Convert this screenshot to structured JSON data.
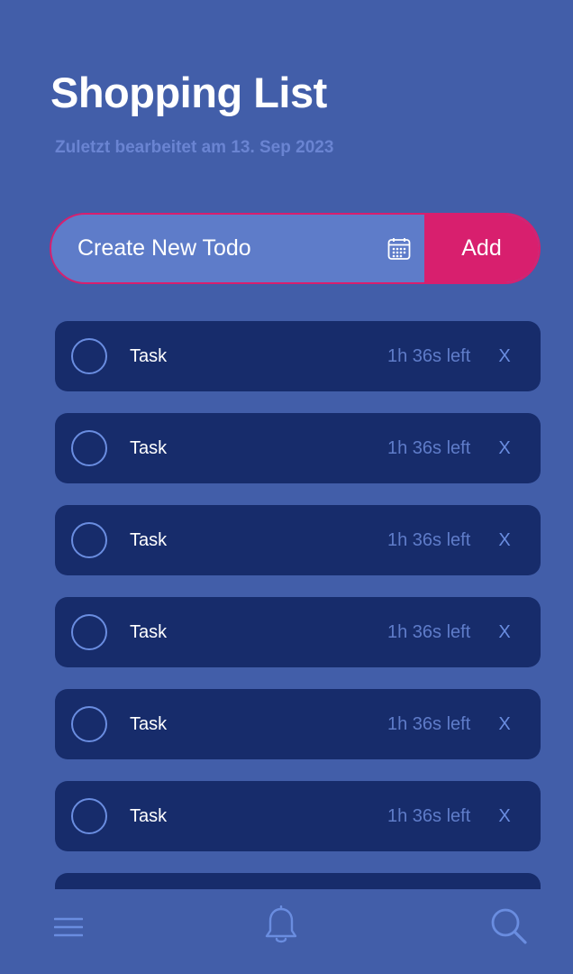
{
  "header": {
    "title": "Shopping List",
    "subtitle": "Zuletzt bearbeitet am 13. Sep 2023"
  },
  "create_bar": {
    "placeholder": "Create New Todo",
    "calendar_icon": "calendar-icon",
    "add_label": "Add"
  },
  "todos": [
    {
      "label": "Task",
      "time_left": "1h 36s left",
      "delete_label": "X",
      "done": false
    },
    {
      "label": "Task",
      "time_left": "1h 36s left",
      "delete_label": "X",
      "done": false
    },
    {
      "label": "Task",
      "time_left": "1h 36s left",
      "delete_label": "X",
      "done": false
    },
    {
      "label": "Task",
      "time_left": "1h 36s left",
      "delete_label": "X",
      "done": false
    },
    {
      "label": "Task",
      "time_left": "1h 36s left",
      "delete_label": "X",
      "done": false
    },
    {
      "label": "Task",
      "time_left": "1h 36s left",
      "delete_label": "X",
      "done": false
    },
    {
      "label": "",
      "time_left": "",
      "delete_label": "",
      "done": false
    }
  ],
  "bottom_nav": {
    "items": [
      "menu-icon",
      "bell-icon",
      "search-icon"
    ]
  },
  "colors": {
    "background": "#425ea9",
    "card": "#172c6b",
    "accent": "#d81f6e",
    "input_fill": "#5e7cc9",
    "muted_text": "#5f7cc9",
    "subtitle": "#6a84d2"
  }
}
